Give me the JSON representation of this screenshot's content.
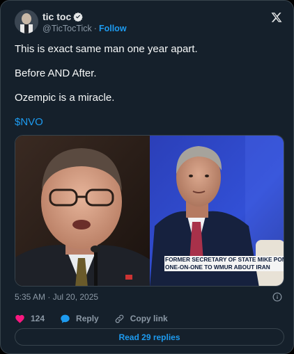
{
  "author": {
    "name": "tic toc",
    "handle": "@TicTocTick",
    "separator": "·",
    "follow_label": "Follow",
    "verified": true
  },
  "tweet": {
    "lines": [
      "This is exact same man one year apart.",
      "Before AND After.",
      "Ozempic is a miracle."
    ],
    "cashtag": "$NVO"
  },
  "media": {
    "caption_line1": "FORMER SECRETARY OF STATE MIKE POMPEO TAL",
    "caption_line2": "ONE-ON-ONE TO WMUR ABOUT IRAN"
  },
  "meta": {
    "timestamp": "5:35 AM · Jul 20, 2025"
  },
  "actions": {
    "like_count": "124",
    "reply_label": "Reply",
    "copy_link_label": "Copy link",
    "read_replies_label": "Read 29 replies"
  },
  "colors": {
    "background": "#15202b",
    "accent": "#1d9bf0",
    "like": "#f91880",
    "muted": "#8b98a5"
  },
  "icons": {
    "close": "x-logo-icon",
    "verified": "verified-badge-icon",
    "info": "info-icon",
    "like": "heart-icon",
    "reply": "speech-bubble-icon",
    "copy_link": "link-icon"
  }
}
